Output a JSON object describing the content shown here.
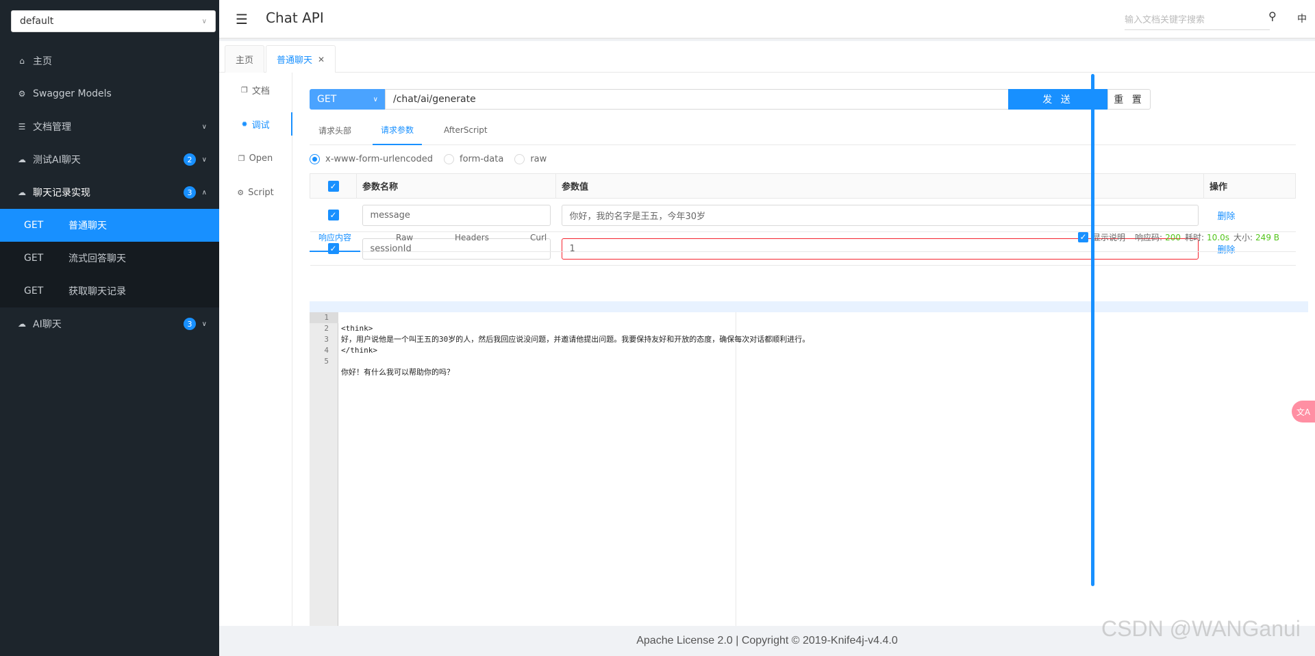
{
  "sidebar": {
    "group_select": "default",
    "items": [
      {
        "label": "主页",
        "icon": "home-icon"
      },
      {
        "label": "Swagger Models",
        "icon": "model-icon"
      },
      {
        "label": "文档管理",
        "icon": "doc-manage-icon"
      },
      {
        "label": "测试AI聊天",
        "icon": "cloud-icon",
        "badge": "2"
      },
      {
        "label": "聊天记录实现",
        "icon": "cloud-icon",
        "badge": "3"
      },
      {
        "label": "AI聊天",
        "icon": "cloud-icon",
        "badge": "3"
      }
    ],
    "sub_items": [
      {
        "method": "GET",
        "label": "普通聊天",
        "active": true
      },
      {
        "method": "GET",
        "label": "流式回答聊天"
      },
      {
        "method": "GET",
        "label": "获取聊天记录"
      }
    ]
  },
  "header": {
    "title": "Chat API",
    "search_placeholder": "输入文档关键字搜索",
    "lang": "中"
  },
  "tabs": [
    {
      "label": "主页"
    },
    {
      "label": "普通聊天",
      "active": true
    }
  ],
  "side_tabs": [
    {
      "label": "文档"
    },
    {
      "label": "调试",
      "active": true
    },
    {
      "label": "Open"
    },
    {
      "label": "Script"
    }
  ],
  "request": {
    "method": "GET",
    "url": "/chat/ai/generate",
    "send_label": "发 送",
    "reset_label": "重 置",
    "tabs": [
      "请求头部",
      "请求参数",
      "AfterScript"
    ],
    "body_types": [
      "x-www-form-urlencoded",
      "form-data",
      "raw"
    ],
    "table_headers": {
      "name": "参数名称",
      "value": "参数值",
      "op": "操作"
    },
    "params": [
      {
        "name": "message",
        "value": "你好，我的名字是王五，今年30岁",
        "action": "删除"
      },
      {
        "name": "sessionId",
        "value": "1",
        "action": "删除"
      }
    ]
  },
  "response": {
    "tabs": [
      "响应内容",
      "Raw",
      "Headers",
      "Curl"
    ],
    "show_desc_label": "显示说明",
    "code_label": "响应码:",
    "code": "200",
    "time_label": "耗时:",
    "time": "10.0s",
    "size_label": "大小:",
    "size": "249 B",
    "lines": [
      {
        "n": "1",
        "text": "<think>"
      },
      {
        "n": "2",
        "text": "好，用户说他是一个叫王五的30岁的人，然后我回应说没问题，并邀请他提出问题。我要保持友好和开放的态度，确保每次对话都顺利进行。"
      },
      {
        "n": "3",
        "text": "</think>"
      },
      {
        "n": "4",
        "text": ""
      },
      {
        "n": "5",
        "text": "你好！有什么我可以帮助你的吗？"
      }
    ]
  },
  "footer": "Apache License 2.0 | Copyright © 2019-Knife4j-v4.4.0",
  "watermark": "CSDN @WANGanui",
  "float_button": "文A"
}
